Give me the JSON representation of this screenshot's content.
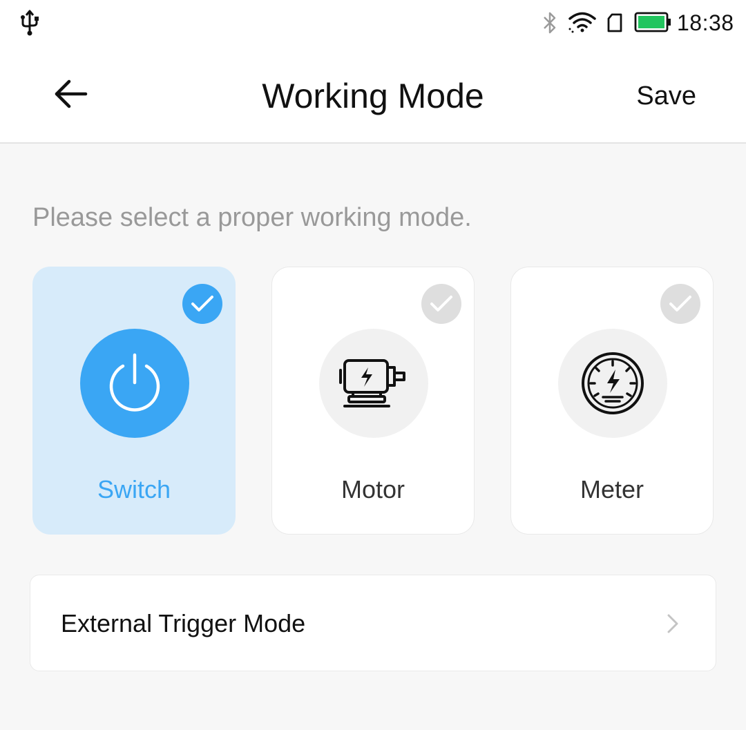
{
  "status_bar": {
    "time": "18:38",
    "battery_color": "#22c55e",
    "icons": [
      "usb-icon",
      "bluetooth-icon",
      "wifi-icon",
      "sim-icon",
      "battery-icon"
    ]
  },
  "header": {
    "title": "Working Mode",
    "save_label": "Save",
    "back_icon": "arrow-left-icon"
  },
  "hint": "Please select a proper working mode.",
  "modes": [
    {
      "label": "Switch",
      "icon": "power-icon",
      "selected": true
    },
    {
      "label": "Motor",
      "icon": "motor-icon",
      "selected": false
    },
    {
      "label": "Meter",
      "icon": "meter-icon",
      "selected": false
    }
  ],
  "external_trigger": {
    "label": "External Trigger Mode",
    "icon": "chevron-right-icon"
  },
  "colors": {
    "accent": "#3aa6f4",
    "selected_bg": "#d7ebfa",
    "hint_text": "#999999"
  }
}
